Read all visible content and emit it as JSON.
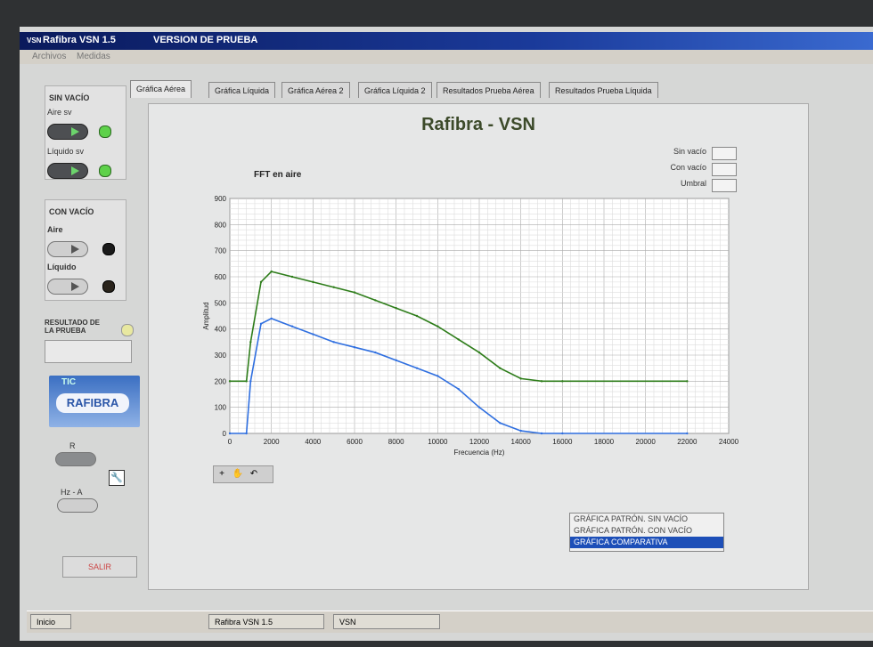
{
  "window": {
    "logo": "VSN",
    "title": "Rafibra VSN  1.5",
    "version_label": "VERSION DE PRUEBA"
  },
  "menu": [
    "Archivos",
    "Medidas"
  ],
  "sin_vacio": {
    "heading": "SIN VACÍO",
    "aire_label": "Aire sv",
    "liquido_label": "Líquido sv"
  },
  "con_vacio": {
    "heading": "CON VACÍO",
    "aire_label": "Aire",
    "liquido_label": "Líquido"
  },
  "resultado": {
    "label": "RESULTADO DE LA PRUEBA"
  },
  "logo": {
    "tic": "TIC",
    "text": "RAFIBRA"
  },
  "controls": {
    "r_label": "R",
    "hza_label": "Hz - A",
    "exit_label": "SALIR"
  },
  "tabs": [
    "Gráfica Aérea",
    "Gráfica Líquida",
    "Gráfica Aérea 2",
    "Gráfica Líquida 2",
    "Resultados Prueba Aérea",
    "Resultados Prueba Líquida"
  ],
  "active_tab": 0,
  "panel": {
    "title": "Rafibra - VSN",
    "plot_name": "FFT en aire",
    "legend": [
      "Sin vacío",
      "Con vacío",
      "Umbral"
    ]
  },
  "zoom_tools": [
    "+",
    "✋",
    "↶"
  ],
  "listbox": {
    "items": [
      "GRÁFICA PATRÓN. SIN VACÍO",
      "GRÁFICA PATRÓN. CON VACÍO",
      "GRÁFICA COMPARATIVA"
    ],
    "selected": 2
  },
  "taskbar": {
    "start": "Inicio",
    "items": [
      "Rafibra VSN  1.5",
      "VSN"
    ]
  },
  "colors": {
    "sin_vacio_series": "#2e7d1a",
    "con_vacio_series": "#2f6fe0",
    "umbral": "#555555"
  },
  "chart_data": {
    "type": "line",
    "xlabel": "Frecuencia (Hz)",
    "ylabel": "Amplitud",
    "xlim": [
      0,
      24000
    ],
    "ylim": [
      0,
      900
    ],
    "xticks": [
      0,
      2000,
      4000,
      6000,
      8000,
      10000,
      12000,
      14000,
      16000,
      18000,
      20000,
      22000,
      24000
    ],
    "yticks": [
      0,
      100,
      200,
      300,
      400,
      500,
      600,
      700,
      800,
      900
    ],
    "grid": true,
    "series": [
      {
        "name": "Sin vacío",
        "x": [
          0,
          800,
          1000,
          1500,
          2000,
          3000,
          4000,
          5000,
          6000,
          7000,
          8000,
          9000,
          10000,
          11000,
          12000,
          13000,
          14000,
          15000,
          16000,
          22000
        ],
        "y": [
          200,
          200,
          350,
          580,
          620,
          600,
          580,
          560,
          540,
          510,
          480,
          450,
          410,
          360,
          310,
          250,
          210,
          200,
          200,
          200
        ]
      },
      {
        "name": "Con vacío",
        "x": [
          0,
          800,
          1000,
          1500,
          2000,
          3000,
          4000,
          5000,
          6000,
          7000,
          8000,
          9000,
          10000,
          11000,
          12000,
          13000,
          14000,
          15000,
          16000,
          22000
        ],
        "y": [
          0,
          0,
          200,
          420,
          440,
          410,
          380,
          350,
          330,
          310,
          280,
          250,
          220,
          170,
          100,
          40,
          10,
          0,
          0,
          0
        ]
      }
    ]
  }
}
